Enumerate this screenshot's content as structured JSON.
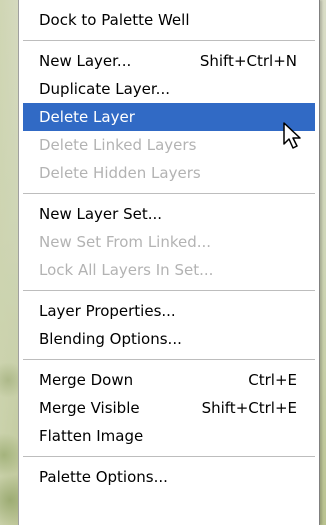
{
  "menu": {
    "items": [
      {
        "label": "Dock to Palette Well",
        "shortcut": "",
        "state": "enabled"
      },
      {
        "separator": true
      },
      {
        "label": "New Layer...",
        "shortcut": "Shift+Ctrl+N",
        "state": "enabled"
      },
      {
        "label": "Duplicate Layer...",
        "shortcut": "",
        "state": "enabled"
      },
      {
        "label": "Delete Layer",
        "shortcut": "",
        "state": "highlighted"
      },
      {
        "label": "Delete Linked Layers",
        "shortcut": "",
        "state": "disabled"
      },
      {
        "label": "Delete Hidden Layers",
        "shortcut": "",
        "state": "disabled"
      },
      {
        "separator": true
      },
      {
        "label": "New Layer Set...",
        "shortcut": "",
        "state": "enabled"
      },
      {
        "label": "New Set From Linked...",
        "shortcut": "",
        "state": "disabled"
      },
      {
        "label": "Lock All Layers In Set...",
        "shortcut": "",
        "state": "disabled"
      },
      {
        "separator": true
      },
      {
        "label": "Layer Properties...",
        "shortcut": "",
        "state": "enabled"
      },
      {
        "label": "Blending Options...",
        "shortcut": "",
        "state": "enabled"
      },
      {
        "separator": true
      },
      {
        "label": "Merge Down",
        "shortcut": "Ctrl+E",
        "state": "enabled"
      },
      {
        "label": "Merge Visible",
        "shortcut": "Shift+Ctrl+E",
        "state": "enabled"
      },
      {
        "label": "Flatten Image",
        "shortcut": "",
        "state": "enabled"
      },
      {
        "separator": true
      },
      {
        "label": "Palette Options...",
        "shortcut": "",
        "state": "enabled"
      }
    ]
  },
  "colors": {
    "highlight": "#316ac5",
    "disabled_text": "#b3b3b3"
  },
  "icons": {
    "cursor": "arrow-cursor-icon"
  }
}
